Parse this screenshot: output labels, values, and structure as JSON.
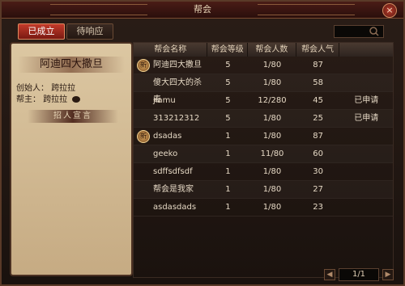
{
  "window": {
    "title": "帮会",
    "close_label": "×"
  },
  "tabs": [
    {
      "label": "已成立",
      "active": true
    },
    {
      "label": "待响应",
      "active": false
    }
  ],
  "left_panel": {
    "guild_name": "阿迪四大撒旦",
    "creator_label": "创始人：",
    "creator_value": "跨拉拉",
    "leader_label": "帮主：",
    "leader_value": "跨拉拉",
    "recruit_label": "招人宣言"
  },
  "table": {
    "headers": [
      "帮会名称",
      "帮会等级",
      "帮会人数",
      "帮会人气",
      ""
    ],
    "rows": [
      {
        "name": "阿迪四大撒旦",
        "level": "5",
        "members": "1/80",
        "popularity": "87",
        "status": "",
        "new": true
      },
      {
        "name": "傻大四大的杀毒",
        "level": "5",
        "members": "1/80",
        "popularity": "58",
        "status": "",
        "new": false
      },
      {
        "name": "jiamu",
        "level": "5",
        "members": "12/280",
        "popularity": "45",
        "status": "已申请",
        "new": false
      },
      {
        "name": "313212312",
        "level": "5",
        "members": "1/80",
        "popularity": "25",
        "status": "已申请",
        "new": false
      },
      {
        "name": "dsadas",
        "level": "1",
        "members": "1/80",
        "popularity": "87",
        "status": "",
        "new": true
      },
      {
        "name": "geeko",
        "level": "1",
        "members": "11/80",
        "popularity": "60",
        "status": "",
        "new": false
      },
      {
        "name": "sdffsdfsdf",
        "level": "1",
        "members": "1/80",
        "popularity": "30",
        "status": "",
        "new": false
      },
      {
        "name": "帮会是我家",
        "level": "1",
        "members": "1/80",
        "popularity": "27",
        "status": "",
        "new": false
      },
      {
        "name": "asdasdads",
        "level": "1",
        "members": "1/80",
        "popularity": "23",
        "status": "",
        "new": false
      }
    ],
    "new_badge_text": "新"
  },
  "pager": {
    "value": "1/1",
    "prev_icon": "◀",
    "next_icon": "▶"
  },
  "colors": {
    "accent": "#c23a2a",
    "panel": "#d8c29c"
  }
}
